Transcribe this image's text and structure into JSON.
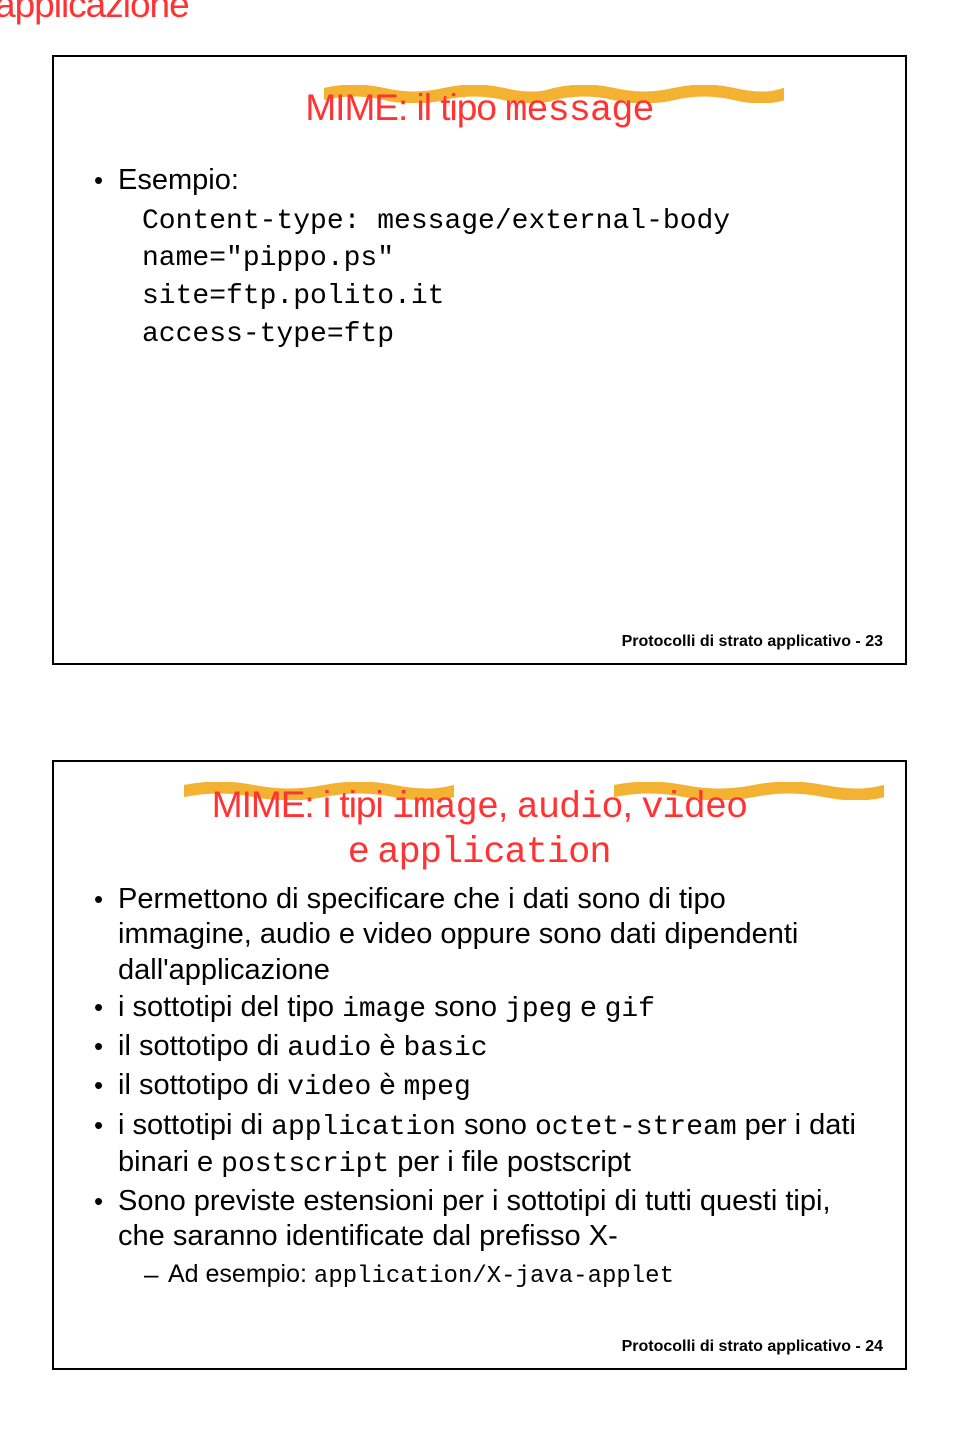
{
  "top_partial": "applicazione",
  "slide1": {
    "title_pre": "MIME: il tipo ",
    "title_mono": "message",
    "bullets": {
      "esempio": "Esempio:",
      "l1": "Content-type: message/external-body",
      "l2": "name=\"pippo.ps\"",
      "l3": "site=ftp.polito.it",
      "l4": "access-type=ftp"
    },
    "footer": "Protocolli di strato applicativo  - 23"
  },
  "slide2": {
    "title_pre": "MIME: i tipi ",
    "title_mono1": "image",
    "title_sep1": ", ",
    "title_mono2": "audio",
    "title_sep2": ", ",
    "title_mono3": "video",
    "title_line2_pre": "e ",
    "title_line2_mono": "application",
    "b1": "Permettono di specificare che i dati sono di tipo immagine, audio e video oppure sono dati dipendenti dall'applicazione",
    "b2_pre": "i sottotipi del tipo ",
    "b2_m1": "image",
    "b2_mid": " sono ",
    "b2_m2": "jpeg",
    "b2_mid2": " e ",
    "b2_m3": "gif",
    "b3_pre": "il sottotipo di ",
    "b3_m1": "audio",
    "b3_mid": " è ",
    "b3_m2": "basic",
    "b4_pre": "il sottotipo di ",
    "b4_m1": "video",
    "b4_mid": " è ",
    "b4_m2": "mpeg",
    "b5_pre": "i sottotipi di ",
    "b5_m1": "application",
    "b5_mid": " sono ",
    "b5_m2": "octet-stream",
    "b5_mid2": " per i dati binari e ",
    "b5_m3": "postscript",
    "b5_end": " per i file postscript",
    "b6": "Sono previste estensioni per i sottotipi di tutti questi tipi, che saranno identificate dal prefisso X-",
    "sub1_pre": "Ad esempio: ",
    "sub1_m": "application/X-java-applet",
    "footer": "Protocolli di strato applicativo  - 24"
  }
}
